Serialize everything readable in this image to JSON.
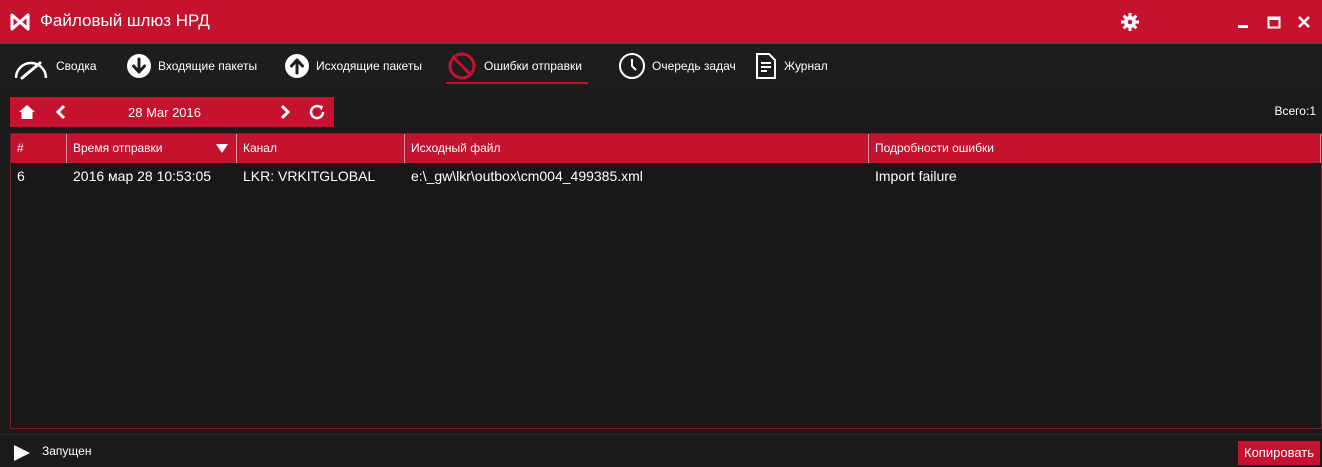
{
  "app": {
    "title": "Файловый шлюз НРД"
  },
  "colors": {
    "accent": "#c4122f",
    "background": "#1b1b1b"
  },
  "nav": {
    "items": [
      {
        "label": "Сводка",
        "icon": "gauge-icon"
      },
      {
        "label": "Входящие пакеты",
        "icon": "arrow-down-circle-icon"
      },
      {
        "label": "Исходящие пакеты",
        "icon": "arrow-up-circle-icon"
      },
      {
        "label": "Ошибки отправки",
        "icon": "prohibited-icon",
        "active": true
      },
      {
        "label": "Очередь задач",
        "icon": "clock-icon"
      },
      {
        "label": "Журнал",
        "icon": "document-icon"
      }
    ]
  },
  "toolbar": {
    "date": "28 Mar 2016",
    "total_label": "Всего:",
    "total_value": "1"
  },
  "table": {
    "columns": [
      "#",
      "Время отправки",
      "Канал",
      "Исходный файл",
      "Подробности ошибки"
    ],
    "sorted_column": "Время отправки",
    "rows": [
      [
        "6",
        "2016 мар 28 10:53:05",
        "LKR: VRKITGLOBAL",
        "e:\\_gw\\lkr\\outbox\\cm004_499385.xml",
        "Import failure"
      ]
    ]
  },
  "status": {
    "text": "Запущен",
    "copy_label": "Копировать"
  }
}
